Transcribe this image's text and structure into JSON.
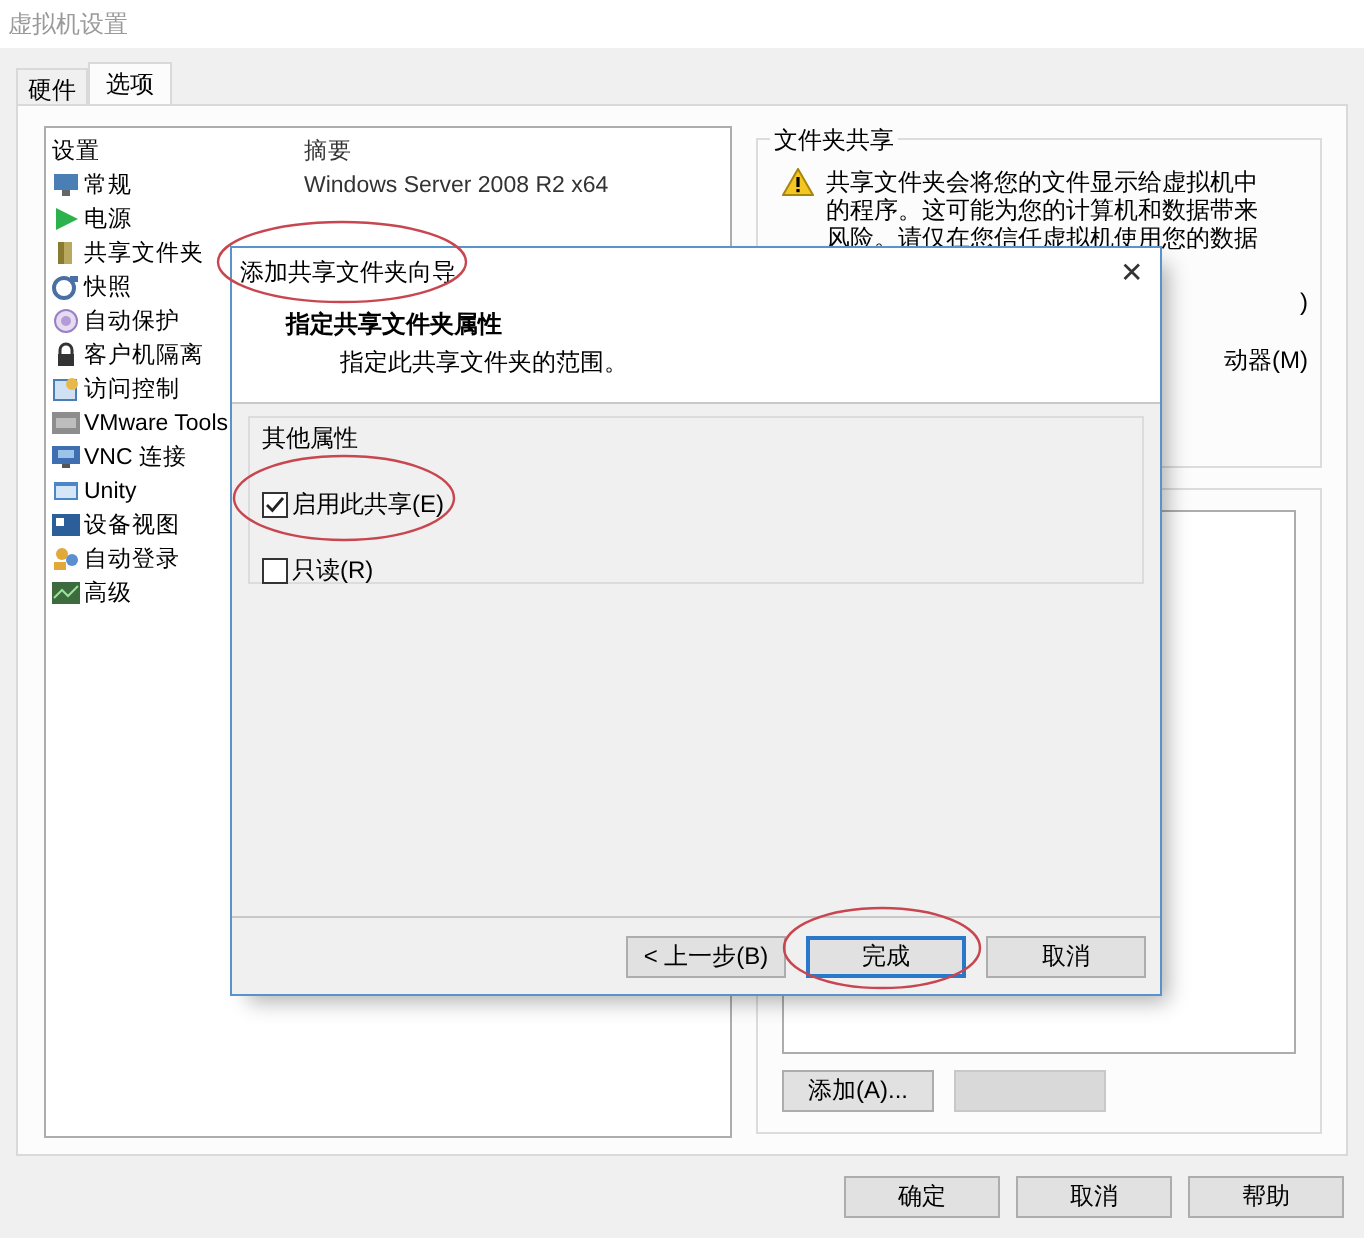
{
  "window": {
    "title": "虚拟机设置"
  },
  "tabs": [
    {
      "label": "硬件",
      "selected": false
    },
    {
      "label": "选项",
      "selected": true
    }
  ],
  "settings_list": {
    "columns": [
      "设置",
      "摘要"
    ],
    "items": [
      {
        "label": "常规",
        "summary": "Windows Server 2008 R2 x64"
      },
      {
        "label": "电源"
      },
      {
        "label": "共享文件夹"
      },
      {
        "label": "快照"
      },
      {
        "label": "自动保护"
      },
      {
        "label": "客户机隔离"
      },
      {
        "label": "访问控制"
      },
      {
        "label": "VMware Tools"
      },
      {
        "label": "VNC 连接"
      },
      {
        "label": "Unity"
      },
      {
        "label": "设备视图"
      },
      {
        "label": "自动登录"
      },
      {
        "label": "高级"
      }
    ]
  },
  "folder_sharing": {
    "title": "文件夹共享",
    "warning_lines": [
      "共享文件夹会将您的文件显示给虚拟机中",
      "的程序。这可能为您的计算机和数据带来",
      "风险。请仅在您信任虚拟机使用您的数据"
    ],
    "partial_texts": [
      ")",
      "动器(M)"
    ]
  },
  "folders": {
    "buttons": [
      {
        "label": "添加(A)...",
        "disabled": false
      },
      {
        "disabled": true
      }
    ]
  },
  "buttons": [
    "确定",
    "取消",
    "帮助"
  ],
  "dialog": {
    "title": "添加共享文件夹向导",
    "title_circled": true,
    "close": "✕",
    "heading": "指定共享文件夹属性",
    "subheading": "指定此共享文件夹的范围。",
    "group": "其他属性",
    "options": [
      {
        "label": "启用此共享(E)",
        "checked": true,
        "circled": true
      },
      {
        "label": "只读(R)",
        "checked": false,
        "circled": false
      }
    ],
    "buttons": [
      {
        "label": "< 上一步(B)",
        "default": false,
        "circled": false
      },
      {
        "label": "完成",
        "default": true,
        "circled": true
      },
      {
        "label": "取消",
        "default": false,
        "circled": false
      }
    ]
  }
}
